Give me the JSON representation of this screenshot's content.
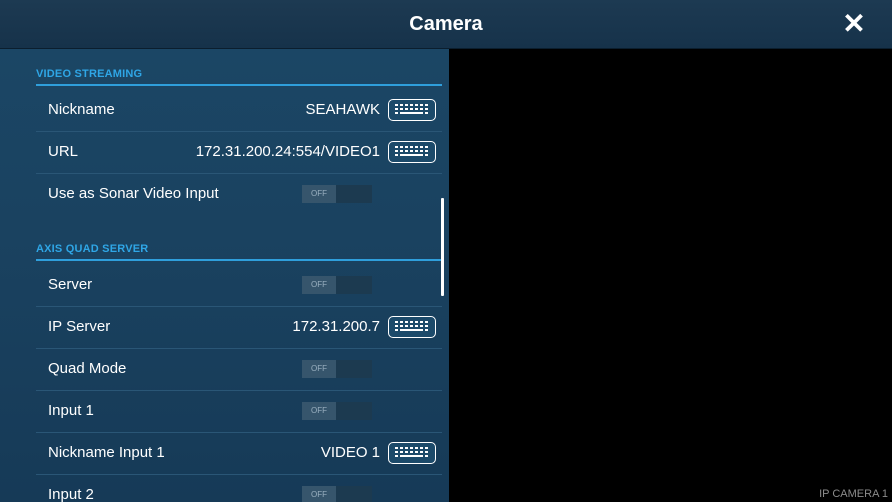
{
  "header": {
    "title": "Camera",
    "close_glyph": "✕"
  },
  "sections": {
    "video_streaming": "VIDEO STREAMING",
    "axis_quad_server": "AXIS QUAD SERVER"
  },
  "rows": {
    "nickname": {
      "label": "Nickname",
      "value": "SEAHAWK"
    },
    "url": {
      "label": "URL",
      "value": "172.31.200.24:554/VIDEO1"
    },
    "sonar": {
      "label": "Use as Sonar Video Input",
      "state": "OFF"
    },
    "server": {
      "label": "Server",
      "state": "OFF"
    },
    "ip_server": {
      "label": "IP Server",
      "value": "172.31.200.7"
    },
    "quad_mode": {
      "label": "Quad Mode",
      "state": "OFF"
    },
    "input1": {
      "label": "Input 1",
      "state": "OFF"
    },
    "nickname_input1": {
      "label": "Nickname Input 1",
      "value": "VIDEO 1"
    },
    "input2": {
      "label": "Input 2",
      "state": "OFF"
    }
  },
  "view": {
    "camera_label": "IP CAMERA 1"
  },
  "colors": {
    "accent": "#2fa6e6",
    "panel": "#1a4260",
    "titlebar": "#1d3a52"
  }
}
